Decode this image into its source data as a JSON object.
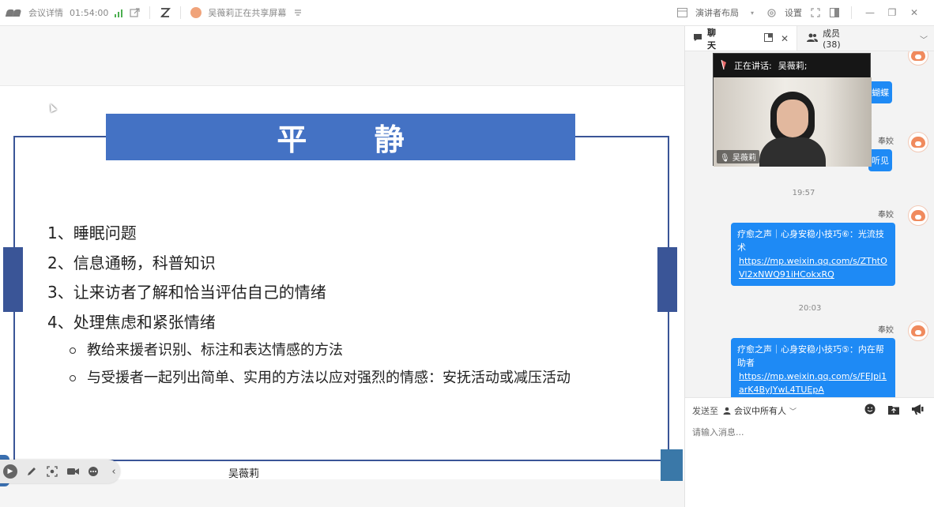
{
  "topbar": {
    "meeting_details": "会议详情",
    "duration": "01:54:00",
    "sharing_status": "吴薇莉正在共享屏幕",
    "layout_label": "演讲者布局",
    "settings_label": "设置"
  },
  "slide": {
    "title": "平  静",
    "items": [
      "1、睡眠问题",
      "2、信息通畅，科普知识",
      "3、让来访者了解和恰当评估自己的情绪",
      "4、处理焦虑和紧张情绪"
    ],
    "sub_items": [
      "教给来援者识别、标注和表达情感的方法",
      "与受援者一起列出简单、实用的方法以应对强烈的情感：安抚活动或减压活动"
    ],
    "speaker_name": "吴薇莉"
  },
  "panel": {
    "chat_tab": "聊天",
    "members_tab": "成员(38)"
  },
  "video": {
    "speaking_label": "正在讲话:",
    "speaker": "吴薇莉;",
    "name_tag": "吴薇莉"
  },
  "chat": {
    "partial1": "蝴蝶",
    "partial2": "听见",
    "time1": "19:57",
    "time2": "20:03",
    "messages": [
      {
        "sender": "奉姣",
        "text": "疗愈之声｜心身安稳小技巧⑥：光流技术",
        "link": "https://mp.weixin.qq.com/s/ZThtOVl2xNWQ91iHCokxRQ"
      },
      {
        "sender": "奉姣",
        "text": "疗愈之声｜心身安稳小技巧⑤：内在帮助者",
        "link": "https://mp.weixin.qq.com/s/FEJpi1arK4ByJYwL4TUEpA"
      }
    ],
    "sender_top": "奉姣"
  },
  "send": {
    "send_to_label": "发送至",
    "recipient": "会议中所有人",
    "placeholder": "请输入消息..."
  }
}
